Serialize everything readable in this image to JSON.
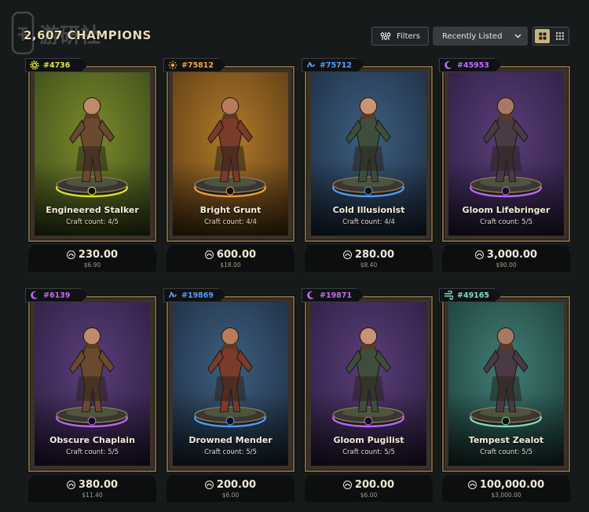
{
  "header": {
    "title": "2,607 CHAMPIONS",
    "filters_label": "Filters",
    "sort_label": "Recently Listed",
    "icons": [
      "filter-icon",
      "chevron-down-icon",
      "grid-large-icon",
      "grid-small-icon"
    ]
  },
  "watermark": {
    "text": "游研社",
    "name": "watermark-logo"
  },
  "colors": {
    "background": "#161a1b",
    "card_border": "#7a6540",
    "toggle_active": "#c7b37d",
    "element_yellow": "#e5ea2a",
    "element_orange": "#f3a53a",
    "element_blue": "#4ea2ff",
    "element_purple": "#c06bff",
    "element_green": "#7fe0c3"
  },
  "cards": [
    {
      "id": "#4736",
      "name": "Engineered Stalker",
      "craft": "Craft count: 4/5",
      "price": "230.00",
      "usd": "$6.90",
      "element": "gear-icon",
      "color": "#e5ea2a",
      "bg": [
        "#7a8a2a",
        "#3b4a1a"
      ]
    },
    {
      "id": "#75812",
      "name": "Bright Grunt",
      "craft": "Craft count: 4/4",
      "price": "600.00",
      "usd": "$18.00",
      "element": "sun-icon",
      "color": "#f3a53a",
      "bg": [
        "#b07a2a",
        "#5a3a14"
      ]
    },
    {
      "id": "#75712",
      "name": "Cold Illusionist",
      "craft": "Craft count: 4/4",
      "price": "280.00",
      "usd": "$8.40",
      "element": "wave-icon",
      "color": "#4ea2ff",
      "bg": [
        "#3e5f80",
        "#1c2c40"
      ]
    },
    {
      "id": "#45953",
      "name": "Gloom Lifebringer",
      "craft": "Craft count: 5/5",
      "price": "3,000.00",
      "usd": "$90.00",
      "element": "moon-icon",
      "color": "#c06bff",
      "bg": [
        "#5a3e7a",
        "#2c1d40"
      ]
    },
    {
      "id": "#6139",
      "name": "Obscure Chaplain",
      "craft": "Craft count: 5/5",
      "price": "380.00",
      "usd": "$11.40",
      "element": "moon-icon",
      "color": "#c06bff",
      "bg": [
        "#5a3e7a",
        "#2c1d40"
      ]
    },
    {
      "id": "#19869",
      "name": "Drowned Mender",
      "craft": "Craft count: 5/5",
      "price": "200.00",
      "usd": "$6.00",
      "element": "wave-icon",
      "color": "#4ea2ff",
      "bg": [
        "#3e5f80",
        "#1c2c40"
      ]
    },
    {
      "id": "#19871",
      "name": "Gloom Pugilist",
      "craft": "Craft count: 5/5",
      "price": "200.00",
      "usd": "$6.00",
      "element": "moon-icon",
      "color": "#c06bff",
      "bg": [
        "#5a3e7a",
        "#2c1d40"
      ]
    },
    {
      "id": "#49165",
      "name": "Tempest Zealot",
      "craft": "Craft count: 5/5",
      "price": "100,000.00",
      "usd": "$3,000.00",
      "element": "wind-icon",
      "color": "#7fe0c3",
      "bg": [
        "#3f7f76",
        "#1d3c38"
      ]
    }
  ]
}
